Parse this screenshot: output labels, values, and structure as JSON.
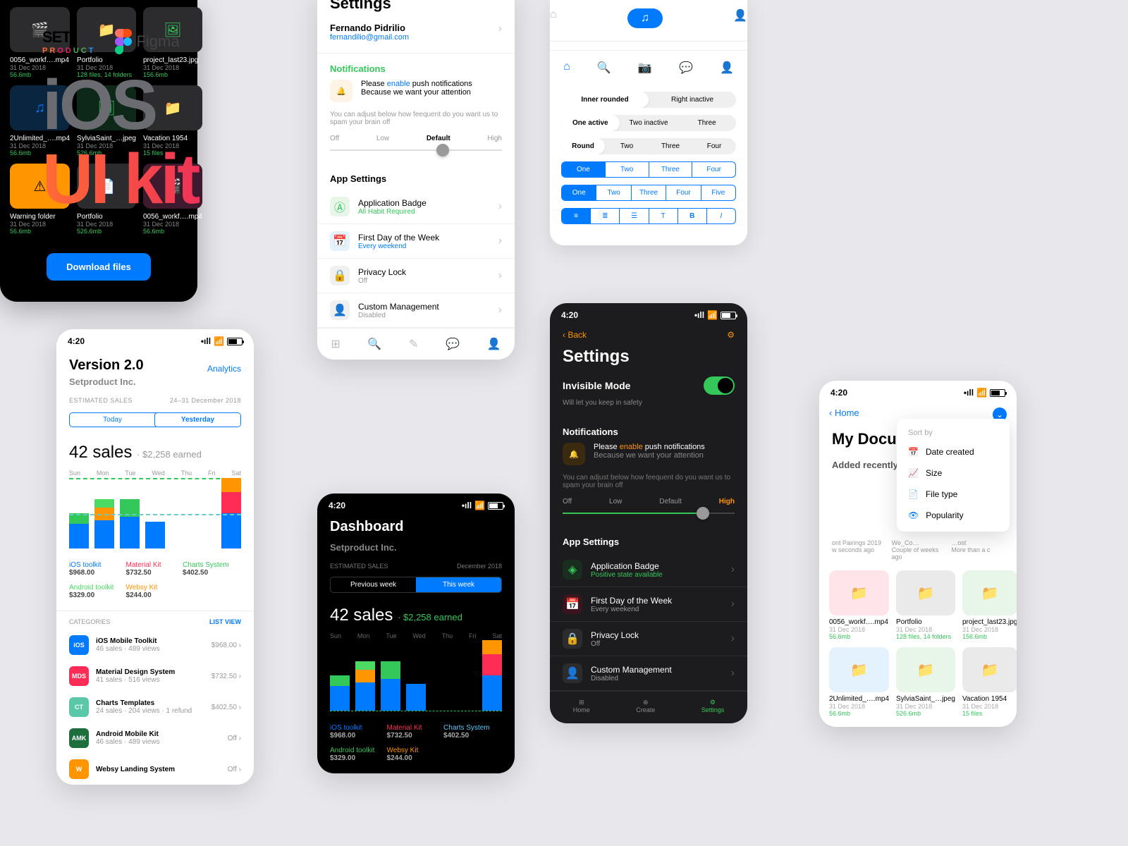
{
  "statusbar_time": "4:20",
  "brand": {
    "set": "SET",
    "product": "PRODUCT",
    "figma": "Figma",
    "ios": "iOS",
    "uikit": "UI kit"
  },
  "settings_light": {
    "title": "Settings",
    "name": "Fernando Pidrilio",
    "email": "fernandilio@gmail.com",
    "notifications_label": "Notifications",
    "notif_text1": "Please ",
    "notif_enable": "enable",
    "notif_text2": " push notifications",
    "notif_text3": "Because we want your attention",
    "help": "You can adjust below how feequent do you want us to spam your brain off",
    "levels": [
      "Off",
      "Low",
      "Default",
      "High"
    ],
    "active_level": "Default",
    "app_settings": "App Settings",
    "rows": [
      {
        "t": "Application Badge",
        "s": "All Habit Required",
        "sc": "#34c759",
        "ic": "#e8f5e9"
      },
      {
        "t": "First Day of the Week",
        "s": "Every weekend",
        "sc": "#007aff",
        "ic": "#e3f2fd"
      },
      {
        "t": "Privacy Lock",
        "s": "Off",
        "sc": "#999",
        "ic": "#f0f0f0"
      },
      {
        "t": "Custom Management",
        "s": "Disabled",
        "sc": "#999",
        "ic": "#f0f0f0"
      }
    ]
  },
  "segments": {
    "pill1": [
      "Inner rounded",
      "Right inactive"
    ],
    "p1act": "Inner rounded",
    "pill2": [
      "One active",
      "Two inactive",
      "Three"
    ],
    "p2act": "One active",
    "pill3": [
      "Round",
      "Two",
      "Three",
      "Four"
    ],
    "p3act": "Round",
    "box1": [
      "One",
      "Two",
      "Three",
      "Four"
    ],
    "b1act": "One",
    "box2": [
      "One",
      "Two",
      "Three",
      "Four",
      "Five"
    ],
    "b2act": "One"
  },
  "files_dark": {
    "items": [
      {
        "name": "0056_workf….mp4",
        "date": "31 Dec 2018",
        "size": "56.6mb",
        "bg": "#2c2c2e",
        "ic": "#ff375f",
        "type": "video"
      },
      {
        "name": "Portfolio",
        "date": "31 Dec 2018",
        "size": "128 files, 14 folders",
        "bg": "#2c2c2e",
        "ic": "#8e8e93",
        "type": "folder"
      },
      {
        "name": "project_last23.jpg",
        "date": "31 Dec 2018",
        "size": "156.6mb",
        "bg": "#2c2c2e",
        "ic": "#34c759",
        "type": "image"
      },
      {
        "name": "2Unlimited_….mp4",
        "date": "31 Dec 2018",
        "size": "56.6mb",
        "bg": "#0a2540",
        "ic": "#007aff",
        "type": "music"
      },
      {
        "name": "SylviaSaint_…jpeg",
        "date": "31 Dec 2018",
        "size": "526.6mb",
        "bg": "#0d2818",
        "ic": "#34c759",
        "type": "image"
      },
      {
        "name": "Vacation 1954",
        "date": "31 Dec 2018",
        "size": "15 files",
        "bg": "#2c2c2e",
        "ic": "#8e8e93",
        "type": "folder"
      },
      {
        "name": "Warning folder",
        "date": "31 Dec 2018",
        "size": "56.6mb",
        "bg": "#ff9500",
        "ic": "#000",
        "type": "warn"
      },
      {
        "name": "Portfolio",
        "date": "31 Dec 2018",
        "size": "526.6mb",
        "bg": "#2c2c2e",
        "ic": "#8e8e93",
        "type": "file"
      },
      {
        "name": "0056_workf….mp4",
        "date": "31 Dec 2018",
        "size": "56.6mb",
        "bg": "#3d1a2e",
        "ic": "#ff375f",
        "type": "video"
      }
    ],
    "download": "Download files"
  },
  "version": {
    "title": "Version 2.0",
    "analytics": "Analytics",
    "company": "Setproduct Inc.",
    "est": "ESTIMATED SALES",
    "range": "24–31 December 2018",
    "tabs": [
      "Today",
      "Yesterday"
    ],
    "tab_act": "Yesterday",
    "sales": "42 sales",
    "earned": "· $2,258 earned",
    "days": [
      "Sun",
      "Mon",
      "Tue",
      "Wed",
      "Thu",
      "Fri",
      "Sat"
    ],
    "legend": [
      {
        "n": "iOS toolkit",
        "v": "$968.00",
        "c": "#007aff"
      },
      {
        "n": "Material Kit",
        "v": "$732.50",
        "c": "#ff2d55"
      },
      {
        "n": "Charts System",
        "v": "$402.50",
        "c": "#34c759"
      },
      {
        "n": "Android toolkit",
        "v": "$329.00",
        "c": "#4cd964"
      },
      {
        "n": "Websy Kit",
        "v": "$244.00",
        "c": "#ff9500"
      }
    ],
    "cat_label": "CATEGORIES",
    "list_view": "LIST VIEW",
    "cats": [
      {
        "b": "iOS",
        "bc": "#007aff",
        "t": "iOS Mobile Toolkit",
        "s": "46 sales · 489 views",
        "p": "$968.00"
      },
      {
        "b": "MDS",
        "bc": "#ff2d55",
        "t": "Material Design System",
        "s": "41 sales · 516 views",
        "p": "$732.50"
      },
      {
        "b": "CT",
        "bc": "#5ac8a8",
        "t": "Charts Templates",
        "s": "24 sales · 204 views · 1 refund",
        "p": "$402.50"
      },
      {
        "b": "AMK",
        "bc": "#1e6e3c",
        "t": "Android Mobile Kit",
        "s": "46 sales · 489 views",
        "p": "Off"
      },
      {
        "b": "W",
        "bc": "#ff9500",
        "t": "Websy Landing System",
        "s": "",
        "p": "Off"
      }
    ]
  },
  "dashboard": {
    "title": "Dashboard",
    "company": "Setproduct Inc.",
    "est": "ESTIMATED SALES",
    "range": "December 2018",
    "tabs": [
      "Previous week",
      "This week"
    ],
    "tab_act": "This week",
    "sales": "42 sales",
    "earned": "· $2,258 earned",
    "days": [
      "Sun",
      "Mon",
      "Tue",
      "Wed",
      "Thu",
      "Fri",
      "Sat"
    ],
    "legend": [
      {
        "n": "iOS toolkit",
        "v": "$968.00",
        "c": "#007aff"
      },
      {
        "n": "Material Kit",
        "v": "$732.50",
        "c": "#ff2d55"
      },
      {
        "n": "Charts System",
        "v": "$402.50",
        "c": "#5ac8fa"
      },
      {
        "n": "Android toolkit",
        "v": "$329.00",
        "c": "#34c759"
      },
      {
        "n": "Websy Kit",
        "v": "$244.00",
        "c": "#ff9500"
      }
    ]
  },
  "settings_dark": {
    "back": "Back",
    "title": "Settings",
    "mode": "Invisible Mode",
    "mode_sub": "Will let you keep in safety",
    "levels": [
      "Off",
      "Low",
      "Default",
      "High"
    ],
    "active_level": "High",
    "nav": [
      "Home",
      "Create",
      "Settings"
    ],
    "rows": [
      {
        "t": "Application Badge",
        "s": "Positive state available",
        "sc": "#34c759",
        "ic": "#1a2e1f"
      },
      {
        "t": "First Day of the Week",
        "s": "Every weekend",
        "sc": "#999",
        "ic": "#3a1520"
      },
      {
        "t": "Privacy Lock",
        "s": "Off",
        "sc": "#999",
        "ic": "#2c2c2e"
      },
      {
        "t": "Custom Management",
        "s": "Disabled",
        "sc": "#999",
        "ic": "#2c2c2e"
      }
    ]
  },
  "docs": {
    "back": "Home",
    "title": "My Docum",
    "sub": "Added recently",
    "sort_label": "Sort by",
    "sort": [
      "Date created",
      "Size",
      "File type",
      "Popularity"
    ],
    "recent": [
      "ont Pairings 2019",
      "We_Co…",
      "…ost"
    ],
    "recent_sub": [
      "w seconds ago",
      "Couple of weeks ago",
      "More than a c"
    ],
    "items": [
      {
        "name": "0056_workf….mp4",
        "date": "31 Dec 2018",
        "size": "56.6mb",
        "bg": "#ffe5ea",
        "ic": "#ff375f"
      },
      {
        "name": "Portfolio",
        "date": "31 Dec 2018",
        "size": "128 files, 14 folders",
        "bg": "#eaeaea",
        "ic": "#8e8e93"
      },
      {
        "name": "project_last23.jpg",
        "date": "31 Dec 2018",
        "size": "156.6mb",
        "bg": "#e8f5e9",
        "ic": "#34c759"
      },
      {
        "name": "2Unlimited_….mp4",
        "date": "31 Dec 2018",
        "size": "56.6mb",
        "bg": "#e3f2fd",
        "ic": "#007aff"
      },
      {
        "name": "SylviaSaint_…jpeg",
        "date": "31 Dec 2018",
        "size": "526.6mb",
        "bg": "#e8f5e9",
        "ic": "#34c759"
      },
      {
        "name": "Vacation 1954",
        "date": "31 Dec 2018",
        "size": "15 files",
        "bg": "#eaeaea",
        "ic": "#8e8e93"
      }
    ]
  },
  "chart_data": {
    "type": "bar",
    "categories": [
      "Sun",
      "Mon",
      "Tue",
      "Wed",
      "Thu",
      "Fri",
      "Sat"
    ],
    "series": [
      {
        "name": "iOS toolkit",
        "color": "#007aff",
        "values": [
          35,
          40,
          45,
          38,
          0,
          0,
          50
        ]
      },
      {
        "name": "Material Kit",
        "color": "#ff2d55",
        "values": [
          0,
          0,
          0,
          0,
          0,
          0,
          30
        ]
      },
      {
        "name": "Charts System",
        "color": "#34c759",
        "values": [
          15,
          0,
          25,
          0,
          0,
          0,
          0
        ]
      },
      {
        "name": "Android toolkit",
        "color": "#4cd964",
        "values": [
          0,
          12,
          0,
          0,
          0,
          0,
          0
        ]
      },
      {
        "name": "Websy Kit",
        "color": "#ff9500",
        "values": [
          0,
          18,
          0,
          0,
          0,
          0,
          20
        ]
      }
    ],
    "title": "42 sales · $2,258 earned"
  }
}
